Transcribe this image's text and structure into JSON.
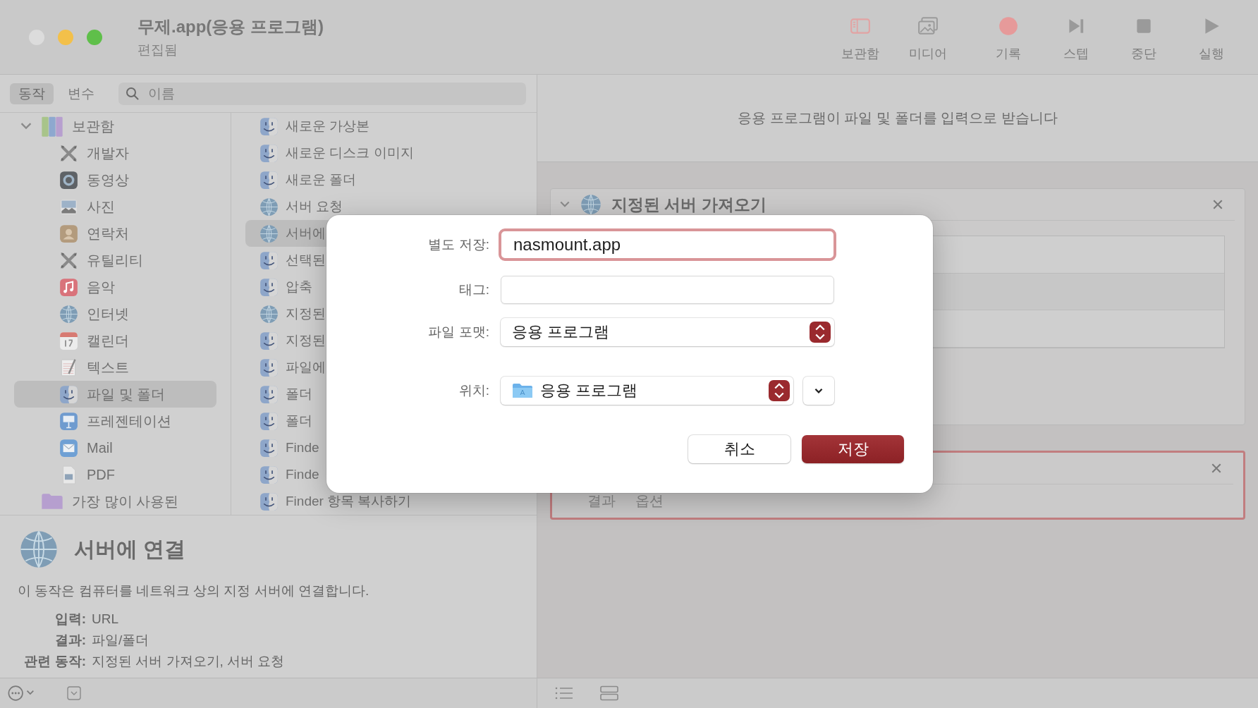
{
  "window": {
    "title": "무제.app(응용 프로그램)",
    "subtitle": "편집됨"
  },
  "toolbar": [
    {
      "label": "보관함",
      "kind": "library"
    },
    {
      "label": "미디어",
      "kind": "media"
    },
    {
      "label": "기록",
      "kind": "record"
    },
    {
      "label": "스텝",
      "kind": "step"
    },
    {
      "label": "중단",
      "kind": "stop"
    },
    {
      "label": "실행",
      "kind": "run"
    }
  ],
  "tabs": [
    {
      "label": "동작",
      "selected": true
    },
    {
      "label": "변수",
      "selected": false
    }
  ],
  "search": {
    "placeholder": "이름"
  },
  "library": [
    {
      "label": "보관함",
      "kind": "library",
      "expanded": true,
      "selected": false,
      "children": [
        {
          "label": "개발자",
          "kind": "tools",
          "selected": false
        },
        {
          "label": "동영상",
          "kind": "video",
          "selected": false
        },
        {
          "label": "사진",
          "kind": "photo",
          "selected": false
        },
        {
          "label": "연락처",
          "kind": "contacts",
          "selected": false
        },
        {
          "label": "유틸리티",
          "kind": "tools",
          "selected": false
        },
        {
          "label": "음악",
          "kind": "music",
          "selected": false
        },
        {
          "label": "인터넷",
          "kind": "globe",
          "selected": false
        },
        {
          "label": "캘린더",
          "kind": "calendar",
          "selected": false
        },
        {
          "label": "텍스트",
          "kind": "text",
          "selected": false
        },
        {
          "label": "파일 및 폴더",
          "kind": "finder",
          "selected": true
        },
        {
          "label": "프레젠테이션",
          "kind": "presentation",
          "selected": false
        },
        {
          "label": "Mail",
          "kind": "mail",
          "selected": false
        },
        {
          "label": "PDF",
          "kind": "pdf",
          "selected": false
        }
      ]
    },
    {
      "label": "가장 많이 사용된",
      "kind": "folder",
      "selected": false
    }
  ],
  "actions": [
    {
      "label": "새로운 가상본",
      "kind": "finder",
      "selected": false
    },
    {
      "label": "새로운 디스크 이미지",
      "kind": "finder",
      "selected": false
    },
    {
      "label": "새로운 폴더",
      "kind": "finder",
      "selected": false
    },
    {
      "label": "서버 요청",
      "kind": "globe",
      "selected": false
    },
    {
      "label": "서버에",
      "kind": "globe",
      "selected": true
    },
    {
      "label": "선택된",
      "kind": "finder",
      "selected": false
    },
    {
      "label": "압축",
      "kind": "finder",
      "selected": false
    },
    {
      "label": "지정된",
      "kind": "globe",
      "selected": false
    },
    {
      "label": "지정된",
      "kind": "finder",
      "selected": false
    },
    {
      "label": "파일에",
      "kind": "finder",
      "selected": false
    },
    {
      "label": "폴더",
      "kind": "finder",
      "selected": false
    },
    {
      "label": "폴더",
      "kind": "finder",
      "selected": false
    },
    {
      "label": "Finde",
      "kind": "finder",
      "selected": false
    },
    {
      "label": "Finde",
      "kind": "finder",
      "selected": false
    },
    {
      "label": "Finder 항목 복사하기",
      "kind": "finder",
      "selected": false
    }
  ],
  "description": {
    "title": "서버에 연결",
    "text": "이 동작은 컴퓨터를 네트워크 상의 지정 서버에 연결합니다.",
    "details": [
      {
        "label": "입력:",
        "value": "URL"
      },
      {
        "label": "결과:",
        "value": "파일/폴더"
      },
      {
        "label": "관련 동작:",
        "value": "지정된 서버 가져오기, 서버 요청"
      }
    ]
  },
  "workflow": {
    "header": "응용 프로그램이 파일 및 폴더를 입력으로 받습니다",
    "actions": [
      {
        "title": "지정된 서버 가져오기",
        "expanded": true,
        "selected": false
      },
      {
        "selected": true,
        "tabs": [
          "결과",
          "옵션"
        ]
      }
    ]
  },
  "dialog": {
    "fields": [
      {
        "kind": "text",
        "label": "별도 저장:",
        "value": "nasmount.app",
        "focused": true
      },
      {
        "kind": "text",
        "label": "태그:",
        "focused": false
      },
      {
        "kind": "popup",
        "label": "파일 포맷:",
        "value": "응용 프로그램"
      },
      {
        "kind": "location",
        "label": "위치:",
        "value": "응용 프로그램"
      }
    ],
    "buttons": [
      {
        "label": "취소",
        "default": false
      },
      {
        "label": "저장",
        "default": true
      }
    ]
  }
}
